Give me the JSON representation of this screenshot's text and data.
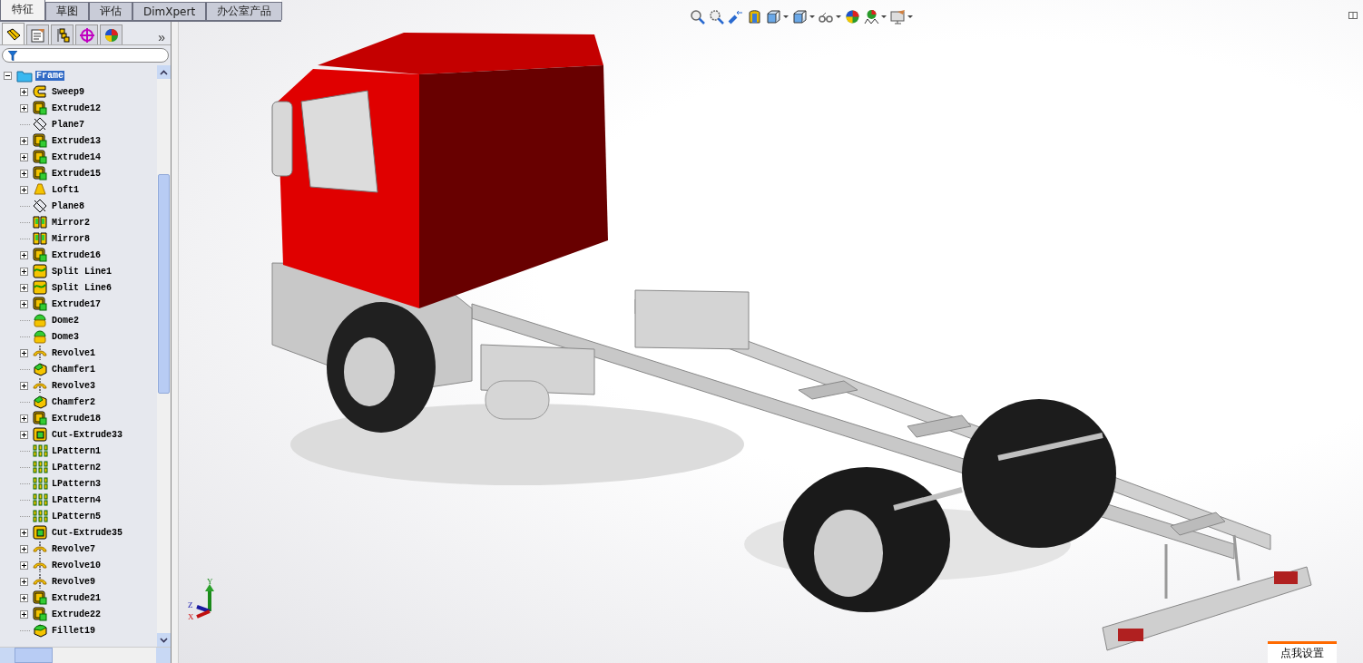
{
  "tabs": [
    {
      "label": "特征",
      "selected": true
    },
    {
      "label": "草图",
      "selected": false
    },
    {
      "label": "评估",
      "selected": false
    },
    {
      "label": "DimXpert",
      "selected": false
    },
    {
      "label": "办公室产品",
      "selected": false
    }
  ],
  "panel_tabs": [
    {
      "kind": "feature-tree",
      "selected": true
    },
    {
      "kind": "property",
      "selected": false
    },
    {
      "kind": "config",
      "selected": false
    },
    {
      "kind": "dimxpert",
      "selected": false
    },
    {
      "kind": "display",
      "selected": false
    }
  ],
  "panel_more": "»",
  "tree": {
    "label": "Frame",
    "selected": true,
    "expanded": true,
    "children": [
      {
        "label": "Sweep9",
        "kind": "sweep",
        "expandable": true
      },
      {
        "label": "Extrude12",
        "kind": "extrude",
        "expandable": true
      },
      {
        "label": "Plane7",
        "kind": "plane",
        "expandable": false
      },
      {
        "label": "Extrude13",
        "kind": "extrude",
        "expandable": true
      },
      {
        "label": "Extrude14",
        "kind": "extrude",
        "expandable": true
      },
      {
        "label": "Extrude15",
        "kind": "extrude",
        "expandable": true
      },
      {
        "label": "Loft1",
        "kind": "loft",
        "expandable": true
      },
      {
        "label": "Plane8",
        "kind": "plane",
        "expandable": false
      },
      {
        "label": "Mirror2",
        "kind": "mirror",
        "expandable": false
      },
      {
        "label": "Mirror8",
        "kind": "mirror",
        "expandable": false
      },
      {
        "label": "Extrude16",
        "kind": "extrude",
        "expandable": true
      },
      {
        "label": "Split Line1",
        "kind": "split",
        "expandable": true
      },
      {
        "label": "Split Line6",
        "kind": "split",
        "expandable": true
      },
      {
        "label": "Extrude17",
        "kind": "extrude",
        "expandable": true
      },
      {
        "label": "Dome2",
        "kind": "dome",
        "expandable": false
      },
      {
        "label": "Dome3",
        "kind": "dome",
        "expandable": false
      },
      {
        "label": "Revolve1",
        "kind": "revolve",
        "expandable": true
      },
      {
        "label": "Chamfer1",
        "kind": "chamfer",
        "expandable": false
      },
      {
        "label": "Revolve3",
        "kind": "revolve",
        "expandable": true
      },
      {
        "label": "Chamfer2",
        "kind": "chamfer",
        "expandable": false
      },
      {
        "label": "Extrude18",
        "kind": "extrude",
        "expandable": true
      },
      {
        "label": "Cut-Extrude33",
        "kind": "cut",
        "expandable": true
      },
      {
        "label": "LPattern1",
        "kind": "pattern",
        "expandable": false
      },
      {
        "label": "LPattern2",
        "kind": "pattern",
        "expandable": false
      },
      {
        "label": "LPattern3",
        "kind": "pattern",
        "expandable": false
      },
      {
        "label": "LPattern4",
        "kind": "pattern",
        "expandable": false
      },
      {
        "label": "LPattern5",
        "kind": "pattern",
        "expandable": false
      },
      {
        "label": "Cut-Extrude35",
        "kind": "cut",
        "expandable": true
      },
      {
        "label": "Revolve7",
        "kind": "revolve",
        "expandable": true
      },
      {
        "label": "Revolve10",
        "kind": "revolve",
        "expandable": true
      },
      {
        "label": "Revolve9",
        "kind": "revolve",
        "expandable": true
      },
      {
        "label": "Extrude21",
        "kind": "extrude",
        "expandable": true
      },
      {
        "label": "Extrude22",
        "kind": "extrude",
        "expandable": true
      },
      {
        "label": "Fillet19",
        "kind": "fillet",
        "expandable": false
      }
    ]
  },
  "toolbar": [
    {
      "kind": "zoom-fit",
      "dropdown": false
    },
    {
      "kind": "zoom-area",
      "dropdown": false
    },
    {
      "kind": "previous-view",
      "dropdown": false
    },
    {
      "kind": "section",
      "dropdown": false
    },
    {
      "kind": "orientation",
      "dropdown": true
    },
    {
      "kind": "display-style",
      "dropdown": true
    },
    {
      "kind": "hide-show",
      "dropdown": true
    },
    {
      "kind": "appearance",
      "dropdown": false
    },
    {
      "kind": "scene",
      "dropdown": true
    },
    {
      "kind": "view-settings",
      "dropdown": true
    }
  ],
  "triad": {
    "y": "Y",
    "z": "Z",
    "x": "X"
  },
  "popup": {
    "label": "点我设置"
  }
}
